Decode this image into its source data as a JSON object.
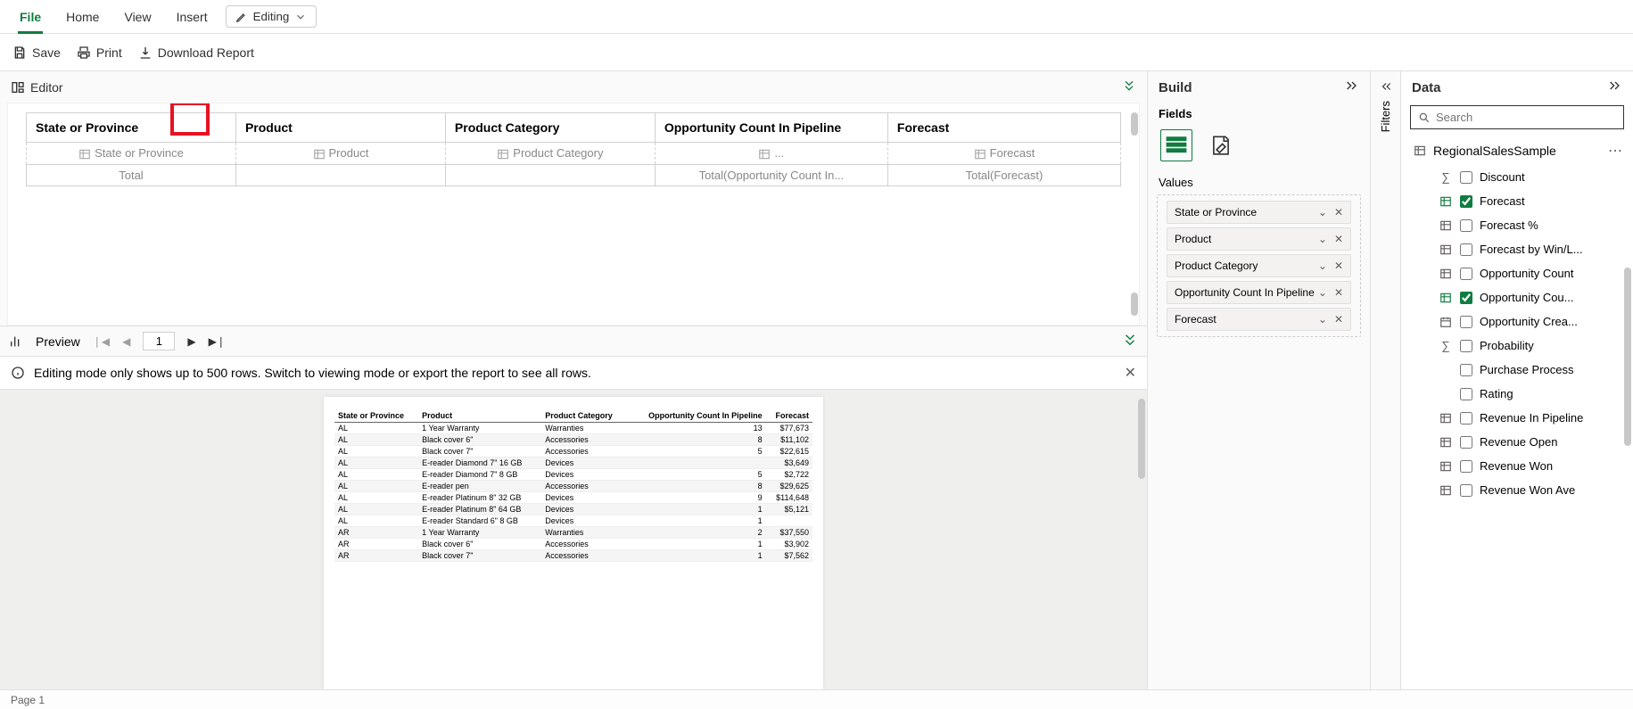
{
  "tabs": {
    "file": "File",
    "home": "Home",
    "view": "View",
    "insert": "Insert",
    "editing": "Editing"
  },
  "toolbar": {
    "save": "Save",
    "print": "Print",
    "download": "Download Report"
  },
  "editor": {
    "title": "Editor",
    "headers": [
      "State or Province",
      "Product",
      "Product Category",
      "Opportunity Count In Pipeline",
      "Forecast"
    ],
    "placeholders": [
      "State or Province",
      "Product",
      "Product Category",
      "...",
      "Forecast"
    ],
    "total_row": [
      "Total",
      "",
      "",
      "Total(Opportunity Count In...",
      "Total(Forecast)"
    ]
  },
  "preview": {
    "title": "Preview",
    "page": "1",
    "info": "Editing mode only shows up to 500 rows. Switch to viewing mode or export the report to see all rows.",
    "cols": [
      "State or Province",
      "Product",
      "Product Category",
      "Opportunity Count In Pipeline",
      "Forecast"
    ],
    "rows": [
      [
        "AL",
        "1 Year Warranty",
        "Warranties",
        "13",
        "$77,673"
      ],
      [
        "AL",
        "Black cover 6\"",
        "Accessories",
        "8",
        "$11,102"
      ],
      [
        "AL",
        "Black cover 7\"",
        "Accessories",
        "5",
        "$22,615"
      ],
      [
        "AL",
        "E-reader Diamond 7\" 16 GB",
        "Devices",
        "",
        "$3,649"
      ],
      [
        "AL",
        "E-reader Diamond 7\" 8 GB",
        "Devices",
        "5",
        "$2,722"
      ],
      [
        "AL",
        "E-reader pen",
        "Accessories",
        "8",
        "$29,625"
      ],
      [
        "AL",
        "E-reader Platinum 8\" 32 GB",
        "Devices",
        "9",
        "$114,648"
      ],
      [
        "AL",
        "E-reader Platinum 8\" 64 GB",
        "Devices",
        "1",
        "$5,121"
      ],
      [
        "AL",
        "E-reader Standard 6\" 8 GB",
        "Devices",
        "1",
        ""
      ],
      [
        "AR",
        "1 Year Warranty",
        "Warranties",
        "2",
        "$37,550"
      ],
      [
        "AR",
        "Black cover 6\"",
        "Accessories",
        "1",
        "$3,902"
      ],
      [
        "AR",
        "Black cover 7\"",
        "Accessories",
        "1",
        "$7,562"
      ]
    ]
  },
  "build": {
    "title": "Build",
    "fields": "Fields",
    "values_label": "Values",
    "values": [
      "State or Province",
      "Product",
      "Product Category",
      "Opportunity Count In Pipeline",
      "Forecast"
    ]
  },
  "filters": {
    "label": "Filters"
  },
  "data": {
    "title": "Data",
    "search_ph": "Search",
    "dataset": "RegionalSalesSample",
    "fields": [
      {
        "icon": "sigma",
        "name": "Discount",
        "checked": false
      },
      {
        "icon": "table-green",
        "name": "Forecast",
        "checked": true
      },
      {
        "icon": "table",
        "name": "Forecast %",
        "checked": false
      },
      {
        "icon": "table",
        "name": "Forecast by Win/L...",
        "checked": false
      },
      {
        "icon": "table",
        "name": "Opportunity Count",
        "checked": false
      },
      {
        "icon": "table-green",
        "name": "Opportunity Cou...",
        "checked": true
      },
      {
        "icon": "calendar",
        "name": "Opportunity Crea...",
        "checked": false
      },
      {
        "icon": "sigma",
        "name": "Probability",
        "checked": false
      },
      {
        "icon": "none",
        "name": "Purchase Process",
        "checked": false
      },
      {
        "icon": "none",
        "name": "Rating",
        "checked": false
      },
      {
        "icon": "table",
        "name": "Revenue In Pipeline",
        "checked": false
      },
      {
        "icon": "table",
        "name": "Revenue Open",
        "checked": false
      },
      {
        "icon": "table",
        "name": "Revenue Won",
        "checked": false
      },
      {
        "icon": "table",
        "name": "Revenue Won Ave",
        "checked": false
      }
    ]
  },
  "footer": {
    "page": "Page 1"
  }
}
